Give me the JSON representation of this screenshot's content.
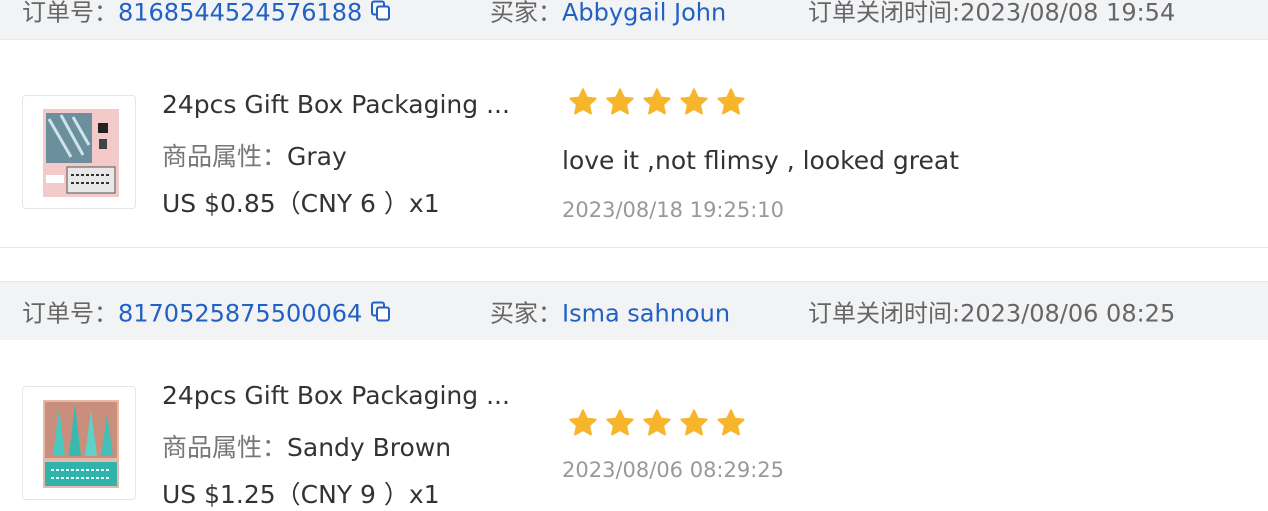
{
  "labels": {
    "order_no": "订单号：",
    "buyer": "买家：",
    "close_time": "订单关闭时间:",
    "attr": "商品属性："
  },
  "orders": [
    {
      "order_no": "8168544524576188",
      "buyer": "Abbygail John",
      "close_time": "2023/08/08 19:54",
      "product_title": "24pcs Gift Box Packaging ...",
      "attribute": "Gray",
      "price": "US $0.85（CNY  6 ）x1",
      "rating": 5,
      "comment": "love it ,not flimsy , looked great",
      "review_time": "2023/08/18 19:25:10"
    },
    {
      "order_no": "8170525875500064",
      "buyer": "Isma sahnoun",
      "close_time": "2023/08/06 08:25",
      "product_title": "24pcs Gift Box Packaging ...",
      "attribute": "Sandy Brown",
      "price": "US $1.25（CNY  9 ）x1",
      "rating": 5,
      "comment": "",
      "review_time": "2023/08/06 08:29:25"
    }
  ],
  "colors": {
    "link": "#2160c4",
    "star": "#f7b52c",
    "header_bg": "#f2f3f5"
  },
  "icons": {
    "copy": "copy-icon",
    "star": "star-icon"
  }
}
